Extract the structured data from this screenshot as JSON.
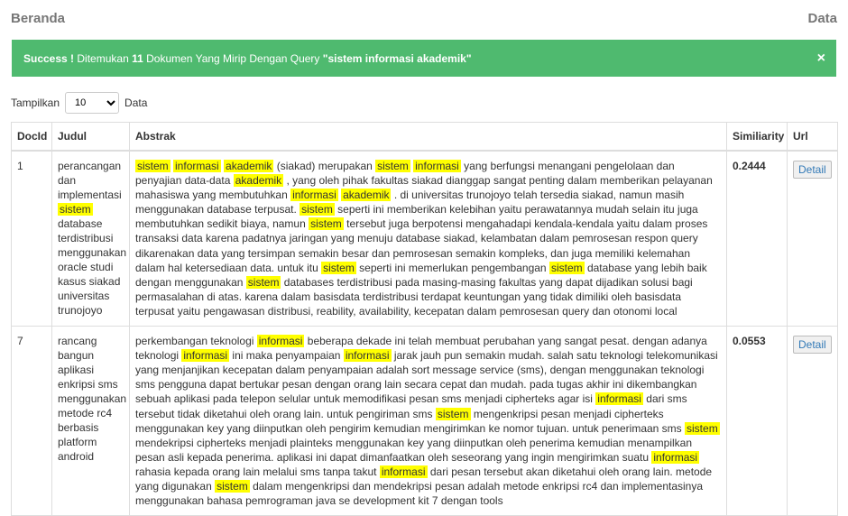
{
  "header": {
    "left": "Beranda",
    "right": "Data"
  },
  "alert": {
    "strong": "Success !",
    "text_pre": " Ditemukan ",
    "count": "11",
    "text_mid": " Dokumen Yang Mirip Dengan Query ",
    "query": "\"sistem informasi akademik\"",
    "close": "×"
  },
  "length": {
    "label_before": "Tampilkan",
    "selected": "10",
    "label_after": "Data"
  },
  "table": {
    "headers": [
      "DocId",
      "Judul",
      "Abstrak",
      "Similiarity",
      "Url"
    ],
    "rows": [
      {
        "docid": "1",
        "judul_pre": "perancangan dan implementasi ",
        "judul_hl": "sistem",
        "judul_post": " database terdistribusi menggunakan oracle studi kasus siakad universitas trunojoyo",
        "abstrak": [
          {
            "t": "sistem",
            "h": 1
          },
          {
            "t": " "
          },
          {
            "t": "informasi",
            "h": 1
          },
          {
            "t": " "
          },
          {
            "t": "akademik",
            "h": 1
          },
          {
            "t": " (siakad) merupakan "
          },
          {
            "t": "sistem",
            "h": 1
          },
          {
            "t": " "
          },
          {
            "t": "informasi",
            "h": 1
          },
          {
            "t": " yang berfungsi menangani pengelolaan dan penyajian data-data "
          },
          {
            "t": "akademik",
            "h": 1
          },
          {
            "t": " , yang oleh pihak fakultas siakad dianggap sangat penting dalam memberikan pelayanan mahasiswa yang membutuhkan "
          },
          {
            "t": "informasi",
            "h": 1
          },
          {
            "t": " "
          },
          {
            "t": "akademik",
            "h": 1
          },
          {
            "t": " . di universitas trunojoyo telah tersedia siakad, namun masih menggunakan database terpusat. "
          },
          {
            "t": "sistem",
            "h": 1
          },
          {
            "t": " seperti ini memberikan kelebihan yaitu perawatannya mudah selain itu juga membutuhkan sedikit biaya, namun "
          },
          {
            "t": "sistem",
            "h": 1
          },
          {
            "t": " tersebut juga berpotensi mengahadapi kendala-kendala yaitu dalam proses transaksi data karena padatnya jaringan yang menuju database siakad, kelambatan dalam pemrosesan respon query dikarenakan data yang tersimpan semakin besar dan pemrosesan semakin kompleks, dan juga memiliki kelemahan dalam hal ketersediaan data. untuk itu "
          },
          {
            "t": "sistem",
            "h": 1
          },
          {
            "t": " seperti ini memerlukan pengembangan "
          },
          {
            "t": "sistem",
            "h": 1
          },
          {
            "t": " database yang lebih baik dengan menggunakan "
          },
          {
            "t": "sistem",
            "h": 1
          },
          {
            "t": " databases terdistribusi pada masing-masing fakultas yang dapat dijadikan solusi bagi permasalahan di atas. karena dalam basisdata terdistribusi terdapat keuntungan yang tidak dimiliki oleh basisdata terpusat yaitu pengawasan distribusi, reability, availability, kecepatan dalam pemrosesan query dan otonomi local"
          }
        ],
        "similarity": "0.2444",
        "button": "Detail"
      },
      {
        "docid": "7",
        "judul_pre": "rancang bangun aplikasi enkripsi sms menggunakan metode rc4 berbasis platform android",
        "judul_hl": "",
        "judul_post": "",
        "abstrak": [
          {
            "t": "perkembangan teknologi "
          },
          {
            "t": "informasi",
            "h": 1
          },
          {
            "t": " beberapa dekade ini telah membuat perubahan yang sangat pesat. dengan adanya teknologi "
          },
          {
            "t": "informasi",
            "h": 1
          },
          {
            "t": " ini maka penyampaian "
          },
          {
            "t": "informasi",
            "h": 1
          },
          {
            "t": " jarak jauh pun semakin mudah. salah satu teknologi telekomunikasi yang menjanjikan kecepatan dalam penyampaian adalah sort message service (sms), dengan menggunakan teknologi sms pengguna dapat bertukar pesan dengan orang lain secara cepat dan mudah. pada tugas akhir ini dikembangkan sebuah aplikasi pada telepon selular untuk memodifikasi pesan sms menjadi cipherteks agar isi "
          },
          {
            "t": "informasi",
            "h": 1
          },
          {
            "t": " dari sms tersebut tidak diketahui oleh orang lain. untuk pengiriman sms "
          },
          {
            "t": "sistem",
            "h": 1
          },
          {
            "t": " mengenkripsi pesan menjadi cipherteks menggunakan key yang diinputkan oleh pengirim kemudian mengirimkan ke nomor tujuan. untuk penerimaan sms "
          },
          {
            "t": "sistem",
            "h": 1
          },
          {
            "t": " mendekripsi cipherteks menjadi plainteks menggunakan key yang diinputkan oleh penerima kemudian menampilkan pesan asli kepada penerima. aplikasi ini dapat dimanfaatkan oleh seseorang yang ingin mengirimkan suatu "
          },
          {
            "t": "informasi",
            "h": 1
          },
          {
            "t": " rahasia kepada orang lain melalui sms tanpa takut "
          },
          {
            "t": "informasi",
            "h": 1
          },
          {
            "t": " dari pesan tersebut akan diketahui oleh orang lain. metode yang digunakan "
          },
          {
            "t": "sistem",
            "h": 1
          },
          {
            "t": " dalam mengenkripsi dan mendekripsi pesan adalah metode enkripsi rc4 dan implementasinya menggunakan bahasa pemrograman java se development kit 7 dengan tools"
          }
        ],
        "similarity": "0.0553",
        "button": "Detail"
      }
    ]
  },
  "colors": {
    "alert_bg": "#4fba6f",
    "highlight": "#ffff00",
    "link": "#337ab7"
  }
}
